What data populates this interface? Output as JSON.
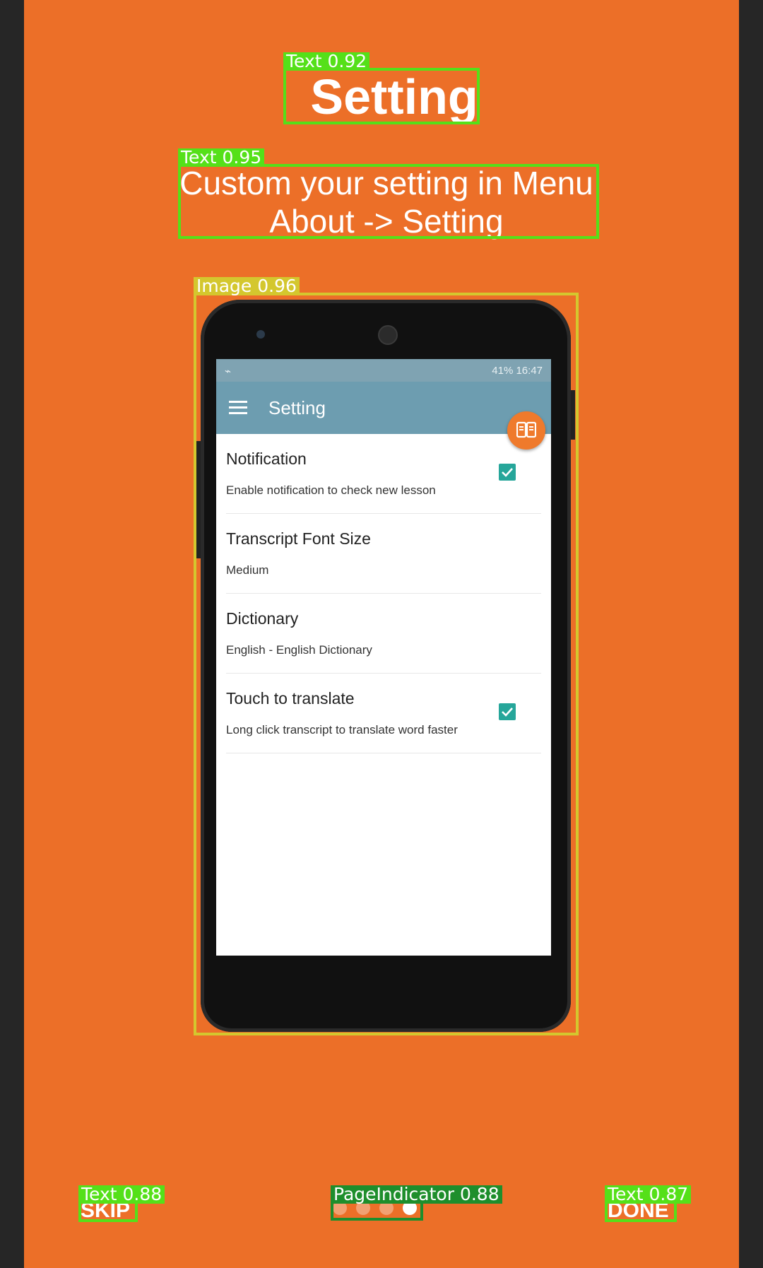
{
  "header": {
    "title": "Setting",
    "subtitle_line1": "Custom your setting in Menu",
    "subtitle_line2": "About -> Setting"
  },
  "phone": {
    "statusbar": {
      "left_icon": "usb-icon",
      "right_text": "41%  16:47"
    },
    "toolbar": {
      "title": "Setting",
      "menu_icon": "menu-icon",
      "fab_icon": "book-icon"
    },
    "prefs": [
      {
        "title": "Notification",
        "summary": "Enable notification to check new lesson",
        "checked": true
      },
      {
        "title": "Transcript Font Size",
        "summary": "Medium",
        "checked": false
      },
      {
        "title": "Dictionary",
        "summary": "English - English Dictionary",
        "checked": false
      },
      {
        "title": "Touch to translate",
        "summary": "Long click transcript to translate word faster",
        "checked": true
      }
    ]
  },
  "footer": {
    "skip": "SKIP",
    "done": "DONE",
    "page_indicator": {
      "count": 4,
      "active": 4
    }
  },
  "overlay": {
    "title_tag": "Text 0.92",
    "subtitle_tag": "Text 0.95",
    "image_tag": "Image 0.96",
    "skip_tag": "Text 0.88",
    "indicator_tag": "PageIndicator 0.88",
    "done_tag": "Text 0.87"
  },
  "colors": {
    "background": "#ec6f28",
    "toolbar": "#6d9db0",
    "checkbox": "#26a69a",
    "detect_green": "#55e019",
    "detect_yellow": "#d4c72e"
  }
}
